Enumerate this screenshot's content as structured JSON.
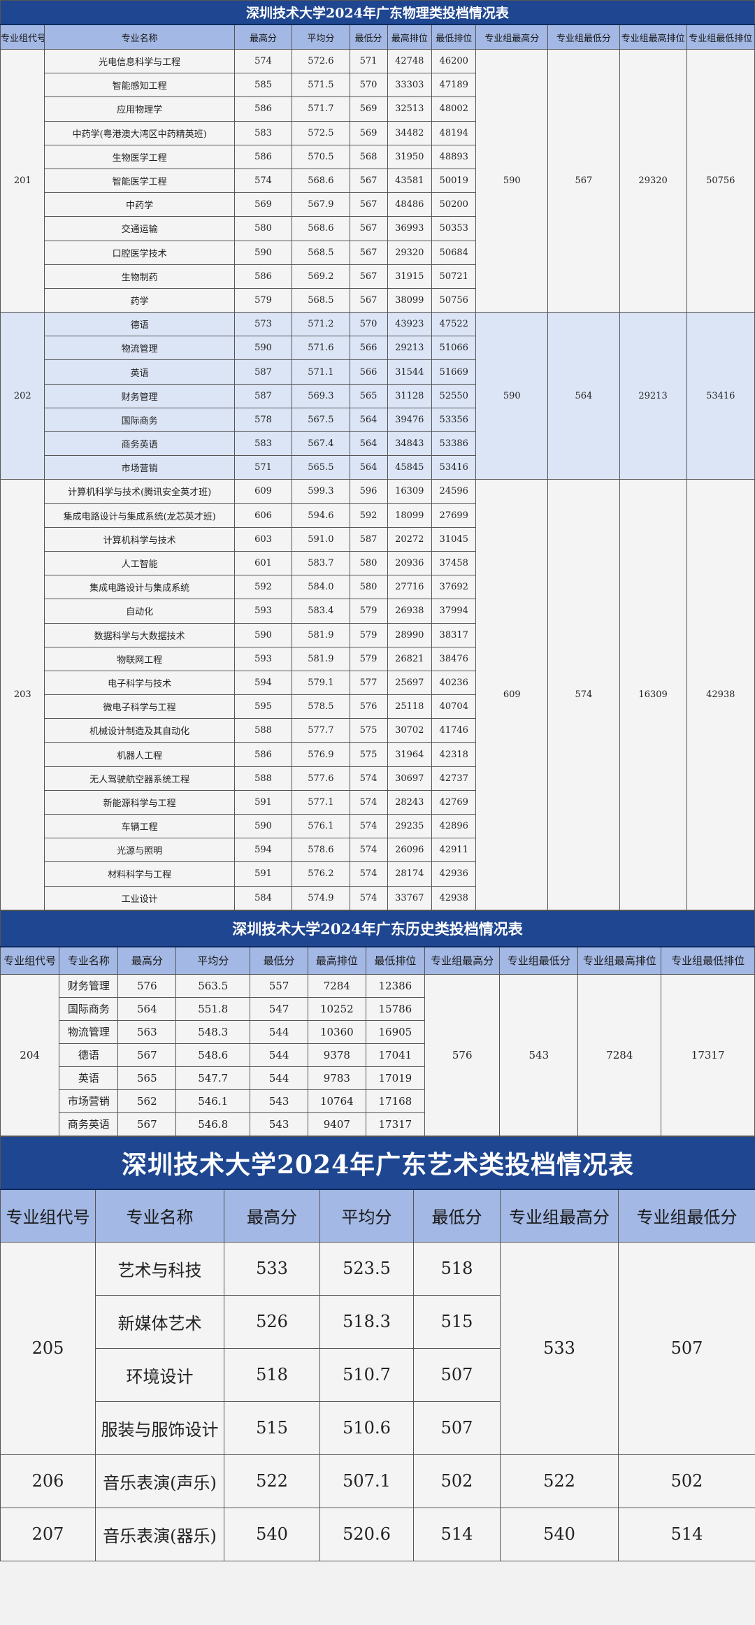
{
  "physics": {
    "title": "深圳技术大学2024年广东物理类投档情况表",
    "headers": [
      "专业组代号",
      "专业名称",
      "最高分",
      "平均分",
      "最低分",
      "最高排位",
      "最低排位",
      "专业组最高分",
      "专业组最低分",
      "专业组最高排位",
      "专业组最低排位"
    ],
    "groups": [
      {
        "code": "201",
        "g_max": "590",
        "g_min": "567",
        "g_max_rank": "29320",
        "g_min_rank": "50756",
        "rows": [
          [
            "光电信息科学与工程",
            "574",
            "572.6",
            "571",
            "42748",
            "46200"
          ],
          [
            "智能感知工程",
            "585",
            "571.5",
            "570",
            "33303",
            "47189"
          ],
          [
            "应用物理学",
            "586",
            "571.7",
            "569",
            "32513",
            "48002"
          ],
          [
            "中药学(粤港澳大湾区中药精英班)",
            "583",
            "572.5",
            "569",
            "34482",
            "48194"
          ],
          [
            "生物医学工程",
            "586",
            "570.5",
            "568",
            "31950",
            "48893"
          ],
          [
            "智能医学工程",
            "574",
            "568.6",
            "567",
            "43581",
            "50019"
          ],
          [
            "中药学",
            "569",
            "567.9",
            "567",
            "48486",
            "50200"
          ],
          [
            "交通运输",
            "580",
            "568.6",
            "567",
            "36993",
            "50353"
          ],
          [
            "口腔医学技术",
            "590",
            "568.5",
            "567",
            "29320",
            "50684"
          ],
          [
            "生物制药",
            "586",
            "569.2",
            "567",
            "31915",
            "50721"
          ],
          [
            "药学",
            "579",
            "568.5",
            "567",
            "38099",
            "50756"
          ]
        ]
      },
      {
        "code": "202",
        "g_max": "590",
        "g_min": "564",
        "g_max_rank": "29213",
        "g_min_rank": "53416",
        "rows": [
          [
            "德语",
            "573",
            "571.2",
            "570",
            "43923",
            "47522"
          ],
          [
            "物流管理",
            "590",
            "571.6",
            "566",
            "29213",
            "51066"
          ],
          [
            "英语",
            "587",
            "571.1",
            "566",
            "31544",
            "51669"
          ],
          [
            "财务管理",
            "587",
            "569.3",
            "565",
            "31128",
            "52550"
          ],
          [
            "国际商务",
            "578",
            "567.5",
            "564",
            "39476",
            "53356"
          ],
          [
            "商务英语",
            "583",
            "567.4",
            "564",
            "34843",
            "53386"
          ],
          [
            "市场营销",
            "571",
            "565.5",
            "564",
            "45845",
            "53416"
          ]
        ]
      },
      {
        "code": "203",
        "g_max": "609",
        "g_min": "574",
        "g_max_rank": "16309",
        "g_min_rank": "42938",
        "rows": [
          [
            "计算机科学与技术(腾讯安全英才班)",
            "609",
            "599.3",
            "596",
            "16309",
            "24596"
          ],
          [
            "集成电路设计与集成系统(龙芯英才班)",
            "606",
            "594.6",
            "592",
            "18099",
            "27699"
          ],
          [
            "计算机科学与技术",
            "603",
            "591.0",
            "587",
            "20272",
            "31045"
          ],
          [
            "人工智能",
            "601",
            "583.7",
            "580",
            "20936",
            "37458"
          ],
          [
            "集成电路设计与集成系统",
            "592",
            "584.0",
            "580",
            "27716",
            "37692"
          ],
          [
            "自动化",
            "593",
            "583.4",
            "579",
            "26938",
            "37994"
          ],
          [
            "数据科学与大数据技术",
            "590",
            "581.9",
            "579",
            "28990",
            "38317"
          ],
          [
            "物联网工程",
            "593",
            "581.9",
            "579",
            "26821",
            "38476"
          ],
          [
            "电子科学与技术",
            "594",
            "579.1",
            "577",
            "25697",
            "40236"
          ],
          [
            "微电子科学与工程",
            "595",
            "578.5",
            "576",
            "25118",
            "40704"
          ],
          [
            "机械设计制造及其自动化",
            "588",
            "577.7",
            "575",
            "30702",
            "41746"
          ],
          [
            "机器人工程",
            "586",
            "576.9",
            "575",
            "31964",
            "42318"
          ],
          [
            "无人驾驶航空器系统工程",
            "588",
            "577.6",
            "574",
            "30697",
            "42737"
          ],
          [
            "新能源科学与工程",
            "591",
            "577.1",
            "574",
            "28243",
            "42769"
          ],
          [
            "车辆工程",
            "590",
            "576.1",
            "574",
            "29235",
            "42896"
          ],
          [
            "光源与照明",
            "594",
            "578.6",
            "574",
            "26096",
            "42911"
          ],
          [
            "材料科学与工程",
            "591",
            "576.2",
            "574",
            "28174",
            "42936"
          ],
          [
            "工业设计",
            "584",
            "574.9",
            "574",
            "33767",
            "42938"
          ]
        ]
      }
    ]
  },
  "history": {
    "title": "深圳技术大学2024年广东历史类投档情况表",
    "headers": [
      "专业组代号",
      "专业名称",
      "最高分",
      "平均分",
      "最低分",
      "最高排位",
      "最低排位",
      "专业组最高分",
      "专业组最低分",
      "专业组最高排位",
      "专业组最低排位"
    ],
    "groups": [
      {
        "code": "204",
        "g_max": "576",
        "g_min": "543",
        "g_max_rank": "7284",
        "g_min_rank": "17317",
        "rows": [
          [
            "财务管理",
            "576",
            "563.5",
            "557",
            "7284",
            "12386"
          ],
          [
            "国际商务",
            "564",
            "551.8",
            "547",
            "10252",
            "15786"
          ],
          [
            "物流管理",
            "563",
            "548.3",
            "544",
            "10360",
            "16905"
          ],
          [
            "德语",
            "567",
            "548.6",
            "544",
            "9378",
            "17041"
          ],
          [
            "英语",
            "565",
            "547.7",
            "544",
            "9783",
            "17019"
          ],
          [
            "市场营销",
            "562",
            "546.1",
            "543",
            "10764",
            "17168"
          ],
          [
            "商务英语",
            "567",
            "546.8",
            "543",
            "9407",
            "17317"
          ]
        ]
      }
    ]
  },
  "art": {
    "title": "深圳技术大学2024年广东艺术类投档情况表",
    "headers": [
      "专业组代号",
      "专业名称",
      "最高分",
      "平均分",
      "最低分",
      "专业组最高分",
      "专业组最低分"
    ],
    "groups": [
      {
        "code": "205",
        "g_max": "533",
        "g_min": "507",
        "rows": [
          [
            "艺术与科技",
            "533",
            "523.5",
            "518"
          ],
          [
            "新媒体艺术",
            "526",
            "518.3",
            "515"
          ],
          [
            "环境设计",
            "518",
            "510.7",
            "507"
          ],
          [
            "服装与服饰设计",
            "515",
            "510.6",
            "507"
          ]
        ]
      },
      {
        "code": "206",
        "g_max": "522",
        "g_min": "502",
        "rows": [
          [
            "音乐表演(声乐)",
            "522",
            "507.1",
            "502"
          ]
        ]
      },
      {
        "code": "207",
        "g_max": "540",
        "g_min": "514",
        "rows": [
          [
            "音乐表演(器乐)",
            "540",
            "520.6",
            "514"
          ]
        ]
      }
    ]
  }
}
